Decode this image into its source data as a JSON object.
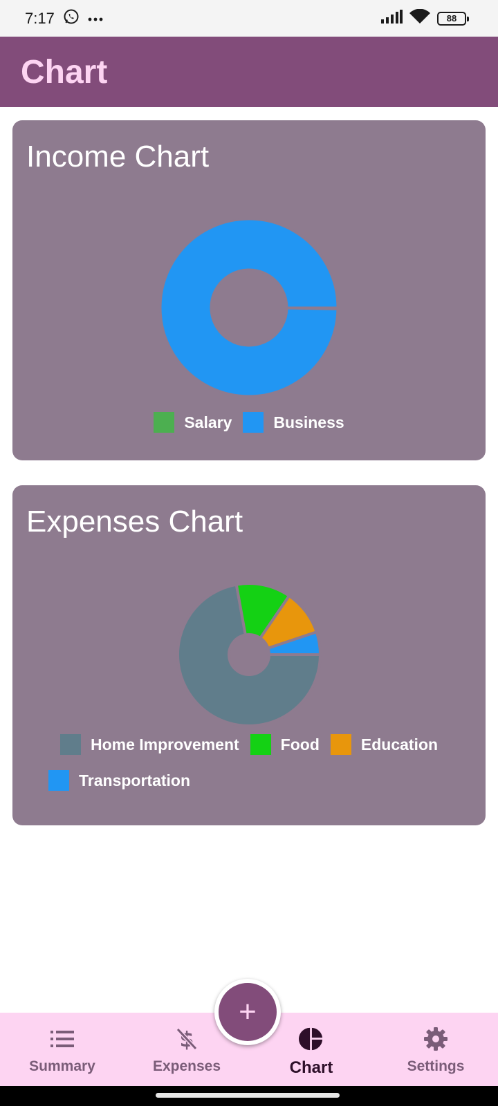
{
  "status_bar": {
    "time": "7:17",
    "battery": "88",
    "icons": [
      "whatsapp-icon",
      "more-dots-icon",
      "signal-icon",
      "wifi-icon",
      "battery-icon"
    ]
  },
  "app_bar": {
    "title": "Chart"
  },
  "income_card": {
    "title": "Income Chart",
    "chart_data": {
      "type": "pie",
      "style": "donut",
      "labels": [
        "Salary",
        "Business"
      ],
      "values": [
        0.3,
        99.7
      ],
      "colors": [
        "#4caf50",
        "#2196f3"
      ],
      "legend_position": "bottom"
    },
    "legend": [
      {
        "label": "Salary",
        "color": "#4caf50"
      },
      {
        "label": "Business",
        "color": "#2196f3"
      }
    ]
  },
  "expenses_card": {
    "title": "Expenses Chart",
    "chart_data": {
      "type": "pie",
      "style": "donut",
      "labels": [
        "Home Improvement",
        "Food",
        "Education",
        "Transportation"
      ],
      "values": [
        70,
        12,
        10,
        5
      ],
      "colors": [
        "#607d8b",
        "#14d114",
        "#e8960c",
        "#2196f3"
      ],
      "legend_position": "bottom"
    },
    "legend": [
      {
        "label": "Home Improvement",
        "color": "#607d8b"
      },
      {
        "label": "Food",
        "color": "#14d114"
      },
      {
        "label": "Education",
        "color": "#e8960c"
      },
      {
        "label": "Transportation",
        "color": "#2196f3"
      }
    ]
  },
  "fab": {
    "label": "+",
    "icon": "plus-icon"
  },
  "bottom_nav": {
    "items": [
      {
        "label": "Summary",
        "icon": "list-icon",
        "active": false
      },
      {
        "label": "Expenses",
        "icon": "dollar-slash-icon",
        "active": false
      },
      {
        "label": "Chart",
        "icon": "pie-chart-icon",
        "active": true
      },
      {
        "label": "Settings",
        "icon": "gear-icon",
        "active": false
      }
    ]
  }
}
